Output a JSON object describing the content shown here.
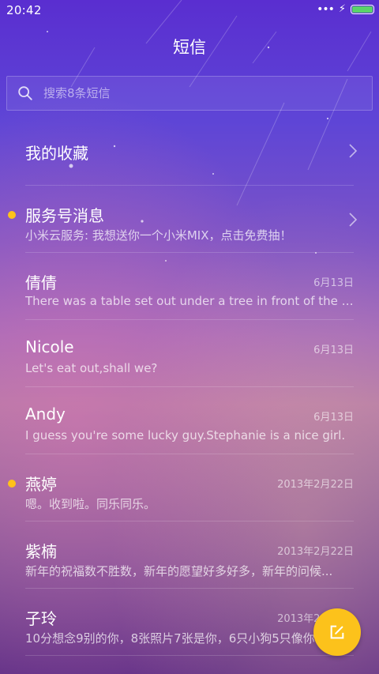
{
  "status_bar": {
    "time": "20:42",
    "signal": "•••",
    "charging": "⚡"
  },
  "header": {
    "title": "短信"
  },
  "search": {
    "placeholder": "搜索8条短信"
  },
  "favorites": {
    "label": "我的收藏"
  },
  "service": {
    "title": "服务号消息",
    "preview": "小米云服务: 我想送你一个小米MIX，点击免费抽！",
    "unread": true
  },
  "conversations": [
    {
      "name": "倩倩",
      "date": "6月13日",
      "preview": "There was a table set out under a tree in front of the ho...",
      "unread": false
    },
    {
      "name": "Nicole",
      "date": "6月13日",
      "preview": "Let's eat out,shall we?",
      "unread": false
    },
    {
      "name": "Andy",
      "date": "6月13日",
      "preview": "I guess you're some lucky guy.Stephanie is a nice girl.",
      "unread": false
    },
    {
      "name": "燕婷",
      "date": "2013年2月22日",
      "preview": "嗯。收到啦。同乐同乐。",
      "unread": true
    },
    {
      "name": "紫楠",
      "date": "2013年2月22日",
      "preview": "新年的祝福数不胜数，新年的愿望好多好多，新年的问候...",
      "unread": false
    },
    {
      "name": "子玲",
      "date": "2013年2月22日",
      "preview": "10分想念9别的你，8张照片7张是你，6只小狗5只像你",
      "unread": false
    }
  ],
  "colors": {
    "accent": "#fcc21b",
    "unread_dot": "#ffc21a",
    "battery": "#5ad36a"
  },
  "icons": {
    "search": "search-icon",
    "chevron": "chevron-right-icon",
    "compose": "compose-icon"
  }
}
